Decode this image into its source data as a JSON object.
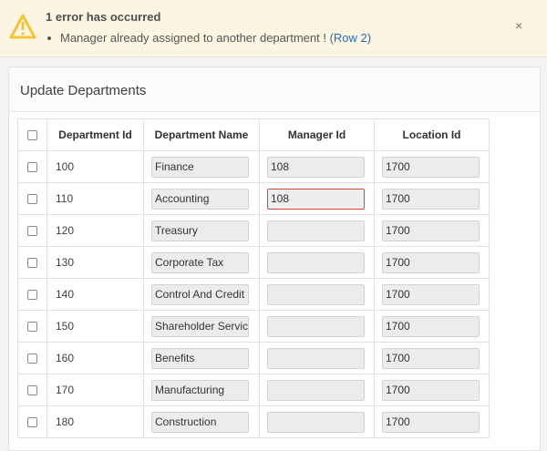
{
  "alert": {
    "title": "1 error has occurred",
    "message": "Manager already assigned to another department ! ",
    "link": "(Row 2)",
    "close": "×"
  },
  "region": {
    "title": "Update Departments"
  },
  "table": {
    "headers": [
      "Department Id",
      "Department Name",
      "Manager Id",
      "Location Id"
    ],
    "rows": [
      {
        "id": "100",
        "name": "Finance",
        "manager": "108",
        "location": "1700"
      },
      {
        "id": "110",
        "name": "Accounting",
        "manager": "108",
        "location": "1700"
      },
      {
        "id": "120",
        "name": "Treasury",
        "manager": "",
        "location": "1700"
      },
      {
        "id": "130",
        "name": "Corporate Tax",
        "manager": "",
        "location": "1700"
      },
      {
        "id": "140",
        "name": "Control And Credit",
        "manager": "",
        "location": "1700"
      },
      {
        "id": "150",
        "name": "Shareholder Services",
        "manager": "",
        "location": "1700"
      },
      {
        "id": "160",
        "name": "Benefits",
        "manager": "",
        "location": "1700"
      },
      {
        "id": "170",
        "name": "Manufacturing",
        "manager": "",
        "location": "1700"
      },
      {
        "id": "180",
        "name": "Construction",
        "manager": "",
        "location": "1700"
      }
    ]
  },
  "colors": {
    "alert_bg": "#fbf5e2",
    "warning": "#f3c43a",
    "error_border": "#d44a3a",
    "link": "#2a6db4"
  }
}
